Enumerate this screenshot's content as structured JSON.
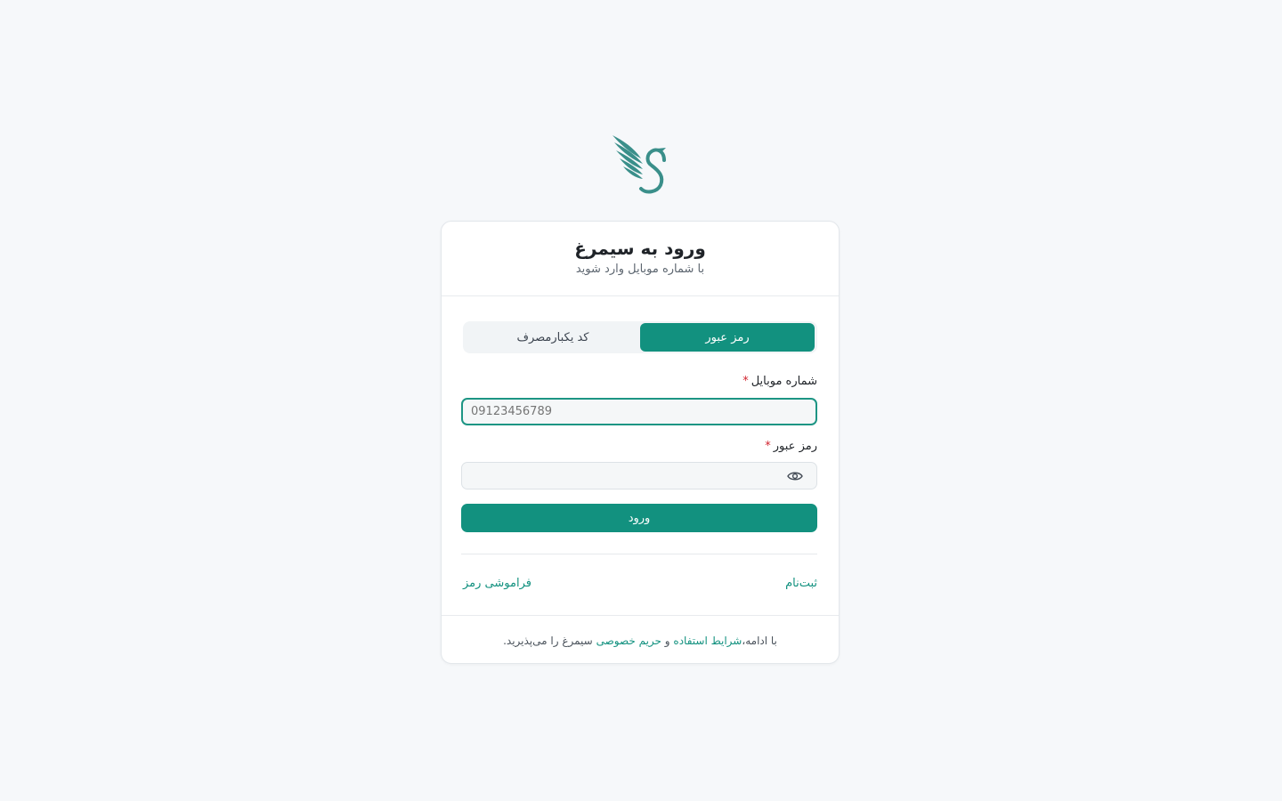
{
  "logo": {
    "name": "simorgh-bird-logo",
    "color": "#3a8f8a"
  },
  "header": {
    "title": "ورود به سیمرغ",
    "subtitle": "با شماره موبایل وارد شوید"
  },
  "tabs": [
    {
      "label": "رمز عبور",
      "active": true
    },
    {
      "label": "کد یکبارمصرف",
      "active": false
    }
  ],
  "form": {
    "phone_label": "شماره موبایل",
    "phone_placeholder": "09123456789",
    "password_label": "رمز عبور",
    "password_placeholder": "",
    "required_mark": "*",
    "submit_label": "ورود"
  },
  "links": {
    "signup": "ثبت‌نام",
    "forgot": "فراموشی رمز"
  },
  "footer": {
    "prefix": "با ادامه،",
    "terms": "شرایط استفاده",
    "and": "و",
    "privacy": "حریم خصوصی",
    "suffix": "سیمرغ را می‌پذیرید."
  },
  "colors": {
    "accent": "#12917f",
    "background": "#f6f8fa",
    "required": "#d1242f"
  },
  "icons": {
    "password_toggle": "eye-icon"
  }
}
